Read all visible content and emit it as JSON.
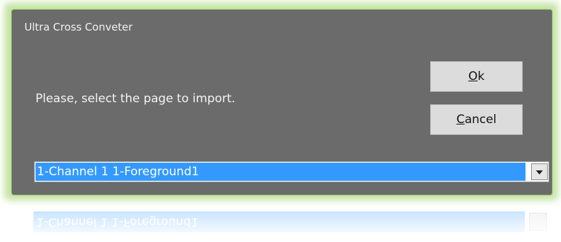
{
  "window": {
    "title": "Ultra Cross Conveter"
  },
  "dialog": {
    "prompt": "Please, select the page to import."
  },
  "buttons": {
    "ok": {
      "mnemonic": "O",
      "rest": "k"
    },
    "cancel": {
      "mnemonic": "C",
      "rest": "ancel"
    }
  },
  "page_select": {
    "selected_value": "1-Channel 1  1-Foreground1"
  },
  "colors": {
    "dialog_background": "#6b6b6b",
    "selection_highlight": "#3399ff",
    "glow": "#96cd5a"
  },
  "icons": {
    "dropdown": "chevron-down-icon"
  }
}
